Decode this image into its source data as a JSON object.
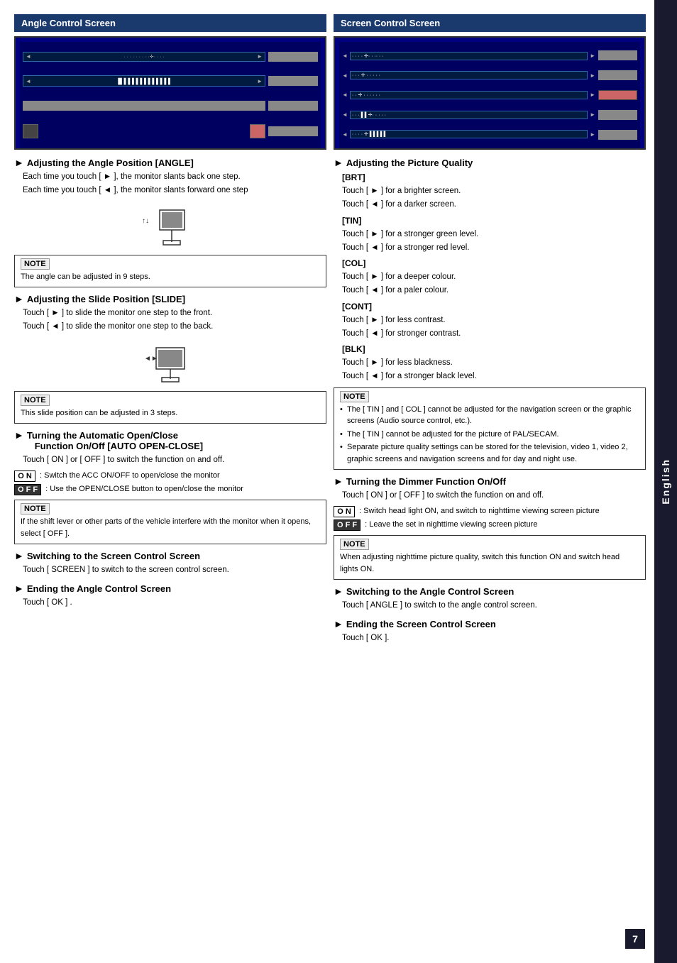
{
  "page": {
    "number": "7",
    "side_tab": "English"
  },
  "left_column": {
    "header": "Angle Control Screen",
    "sections": [
      {
        "id": "adjust-angle",
        "heading_arrow": "►",
        "heading_main": "Adjusting the Angle Position",
        "heading_tag": "[ANGLE]",
        "paragraphs": [
          "Each time you touch [ ► ], the monitor slants back one step.",
          "Each time you touch [ ◄ ], the monitor slants forward one step"
        ]
      },
      {
        "id": "angle-note",
        "note_label": "NOTE",
        "note_text": "The angle can be adjusted in 9 steps."
      },
      {
        "id": "adjust-slide",
        "heading_arrow": "►",
        "heading_main": "Adjusting the Slide Position",
        "heading_tag": "[SLIDE]",
        "paragraphs": [
          "Touch [ ► ] to slide the monitor one step to the front.",
          "Touch [ ◄ ] to slide the monitor one step to the back."
        ]
      },
      {
        "id": "slide-note",
        "note_label": "NOTE",
        "note_text": "This slide position can be adjusted in 3 steps."
      },
      {
        "id": "auto-open-close",
        "heading_arrow": "►",
        "heading_main": "Turning the Automatic Open/Close Function On/Off",
        "heading_tag": "[AUTO OPEN-CLOSE]",
        "paragraphs": [
          "Touch [ ON ] or [ OFF ] to switch the function on and off."
        ],
        "on_label": "O N",
        "off_label": "O F F",
        "on_desc": ": Switch the ACC ON/OFF to open/close the monitor",
        "off_desc": ": Use the OPEN/CLOSE button to open/close the monitor"
      },
      {
        "id": "auto-note",
        "note_label": "NOTE",
        "note_text": "If the shift lever or other parts of the vehicle interfere with the monitor when it opens, select [ OFF ]."
      },
      {
        "id": "switch-screen",
        "heading_arrow": "►",
        "heading_main": "Switching to the Screen Control Screen",
        "paragraphs": [
          "Touch [ SCREEN ] to switch to the screen control screen."
        ]
      },
      {
        "id": "end-angle",
        "heading_arrow": "►",
        "heading_main": "Ending the Angle Control Screen",
        "paragraphs": [
          "Touch [ OK ] ."
        ]
      }
    ]
  },
  "right_column": {
    "header": "Screen Control Screen",
    "sections": [
      {
        "id": "adjust-picture",
        "heading_arrow": "►",
        "heading_main": "Adjusting the Picture Quality",
        "items": [
          {
            "label": "[BRT]",
            "lines": [
              "Touch [ ► ] for a brighter screen.",
              "Touch [ ◄ ] for a darker screen."
            ]
          },
          {
            "label": "[TIN]",
            "lines": [
              "Touch [ ► ] for a stronger green level.",
              "Touch [ ◄ ] for a stronger red level."
            ]
          },
          {
            "label": "[COL]",
            "lines": [
              "Touch [ ► ] for a deeper colour.",
              "Touch [ ◄ ] for a paler colour."
            ]
          },
          {
            "label": "[CONT]",
            "lines": [
              "Touch [ ► ] for less contrast.",
              "Touch [ ◄ ] for stronger contrast."
            ]
          },
          {
            "label": "[BLK]",
            "lines": [
              "Touch [ ► ] for less blackness.",
              "Touch [ ◄ ] for a stronger black level."
            ]
          }
        ]
      },
      {
        "id": "picture-note",
        "note_label": "NOTE",
        "note_bullets": [
          "The [ TIN ] and [ COL ] cannot be adjusted for the navigation screen or the graphic screens (Audio source control, etc.).",
          "The [ TIN ] cannot be adjusted for the picture of PAL/SECAM.",
          "Separate picture quality settings can be stored for the television, video 1, video 2, graphic screens and navigation screens and for day and night use."
        ]
      },
      {
        "id": "dimmer",
        "heading_arrow": "►",
        "heading_main": "Turning the Dimmer Function On/Off",
        "paragraphs": [
          "Touch [ ON ] or [ OFF ] to switch the function on and off."
        ],
        "on_label": "O N",
        "off_label": "O F F",
        "on_desc": ": Switch head light ON, and switch to nighttime viewing screen picture",
        "off_desc": ": Leave the set in nighttime viewing screen picture"
      },
      {
        "id": "dimmer-note",
        "note_label": "NOTE",
        "note_text": "When adjusting nighttime picture quality, switch this function ON and switch head lights ON."
      },
      {
        "id": "switch-angle",
        "heading_arrow": "►",
        "heading_main": "Switching to the Angle Control Screen",
        "paragraphs": [
          "Touch [ ANGLE ] to switch to the angle control screen."
        ]
      },
      {
        "id": "end-screen",
        "heading_arrow": "►",
        "heading_main": "Ending the Screen Control Screen",
        "paragraphs": [
          "Touch [ OK ]."
        ]
      }
    ]
  }
}
